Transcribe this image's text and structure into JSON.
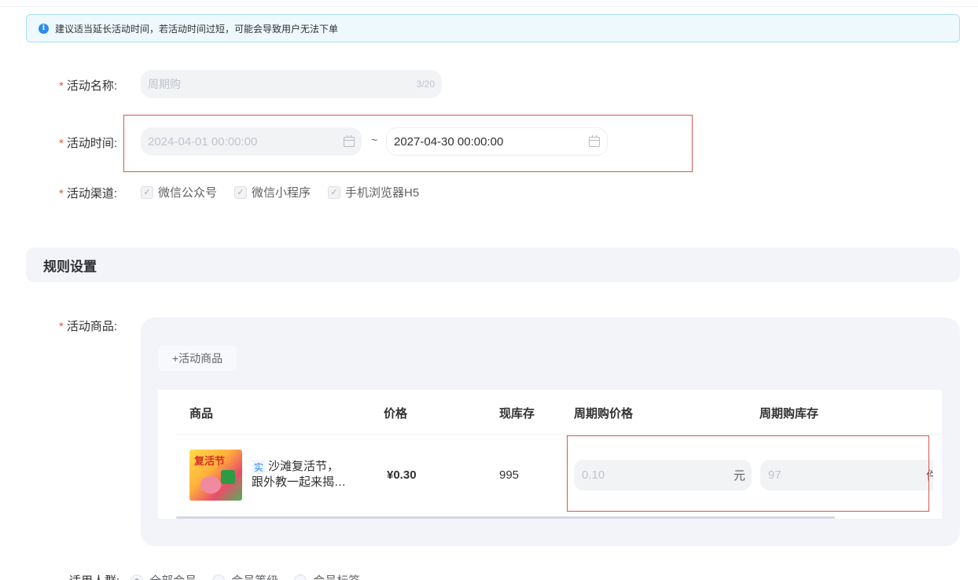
{
  "notice": {
    "text": "建议适当延长活动时间，若活动时间过短，可能会导致用户无法下单"
  },
  "form": {
    "required_mark": "*",
    "name": {
      "label": "活动名称:",
      "placeholder": "周期购",
      "count": "3/20"
    },
    "time": {
      "label": "活动时间:",
      "start": "2024-04-01 00:00:00",
      "separator": "~",
      "end": "2027-04-30 00:00:00"
    },
    "channel": {
      "label": "活动渠道:",
      "options": [
        {
          "label": "微信公众号",
          "checked": true
        },
        {
          "label": "微信小程序",
          "checked": true
        },
        {
          "label": "手机浏览器H5",
          "checked": true
        }
      ]
    }
  },
  "rules": {
    "title": "规则设置",
    "goods_label": "活动商品:",
    "add_button": "+活动商品",
    "table": {
      "headers": [
        "商品",
        "价格",
        "现库存",
        "周期购价格",
        "周期购库存"
      ],
      "rows": [
        {
          "tag": "实",
          "name_line1": "沙滩复活节，",
          "name_line2": "跟外教一起来揭…",
          "thumb_text": "复活节",
          "price": "¥0.30",
          "stock": "995",
          "cycle_price": "0.10",
          "cycle_price_unit": "元",
          "cycle_stock": "97",
          "cycle_stock_unit": "件"
        }
      ]
    }
  },
  "audience": {
    "label": "适用人群:",
    "options": [
      {
        "label": "全部会员",
        "selected": true
      },
      {
        "label": "会员等级",
        "selected": false
      },
      {
        "label": "会员标签",
        "selected": false
      }
    ]
  }
}
